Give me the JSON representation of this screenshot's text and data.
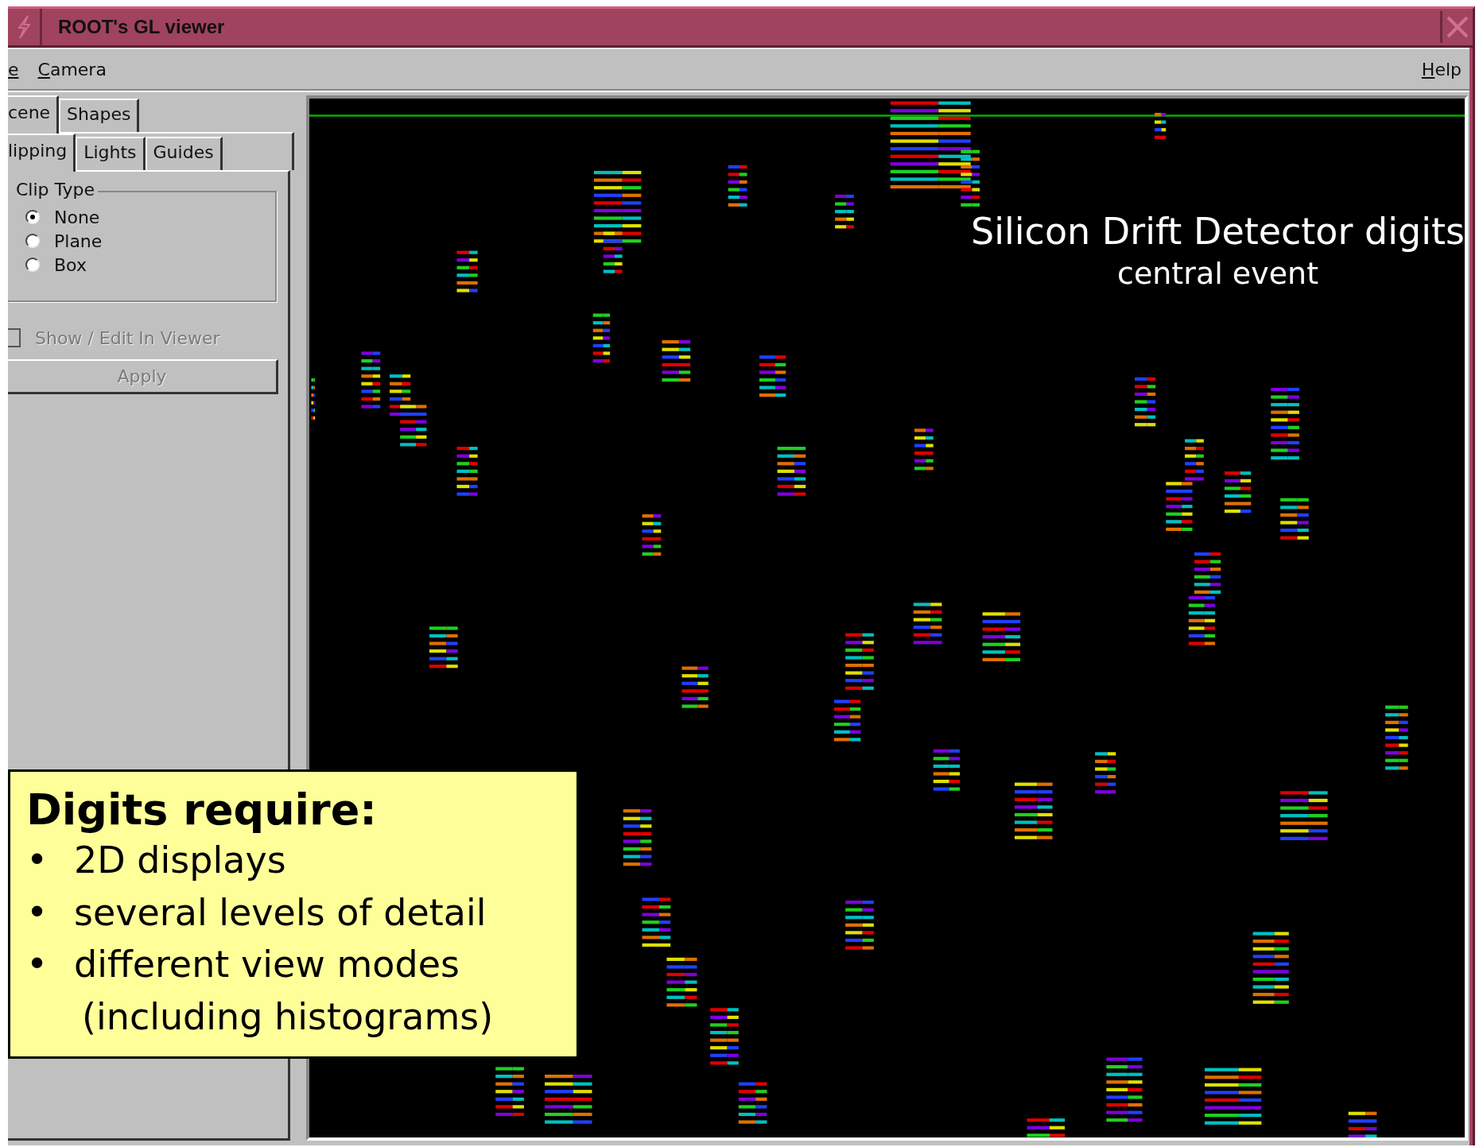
{
  "window": {
    "title": "ROOT's GL viewer"
  },
  "menu": [
    {
      "label": "e"
    },
    {
      "label": "Camera"
    }
  ],
  "help_menu": {
    "label": "Help"
  },
  "tabs": [
    {
      "label": "cene",
      "selected": true
    },
    {
      "label": "Shapes",
      "selected": false
    }
  ],
  "subtabs": [
    {
      "label": "lipping",
      "selected": true
    },
    {
      "label": "Lights",
      "selected": false
    },
    {
      "label": "Guides",
      "selected": false
    }
  ],
  "clip_type": {
    "title": "Clip Type",
    "options": [
      {
        "label": "None",
        "selected": true
      },
      {
        "label": "Plane",
        "selected": false
      },
      {
        "label": "Box",
        "selected": false
      }
    ]
  },
  "show_edit": {
    "label": "Show / Edit In Viewer",
    "checked": false,
    "disabled": true
  },
  "apply_button": {
    "label": "Apply",
    "disabled": true
  },
  "viewer": {
    "title": "Silicon Drift Detector digits",
    "subtitle": "central event"
  },
  "callout": {
    "heading": "Digits require:",
    "items": [
      {
        "marker": "•",
        "text": "2D displays"
      },
      {
        "marker": "•",
        "text": "several levels of detail"
      },
      {
        "marker": "•",
        "text": "different view modes"
      },
      {
        "text": "(including histograms)"
      }
    ]
  }
}
